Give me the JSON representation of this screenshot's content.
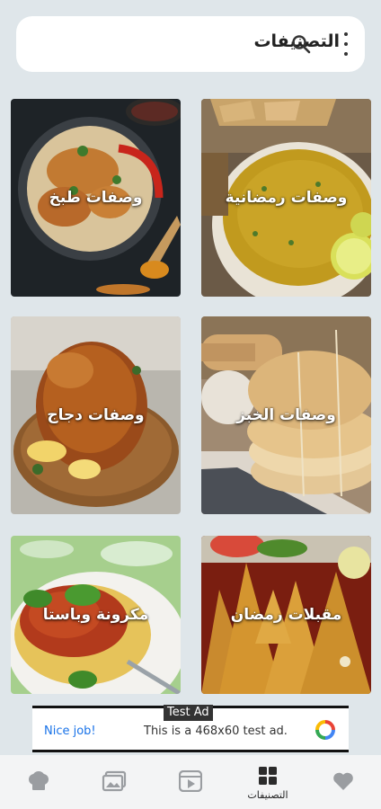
{
  "header": {
    "title": "التصنيفات"
  },
  "categories": [
    {
      "label": "وصفات رمضانية"
    },
    {
      "label": "وصفات طبخ"
    },
    {
      "label": "وصفات الخبز"
    },
    {
      "label": "وصفات دجاج"
    },
    {
      "label": "مقبلات رمضان"
    },
    {
      "label": "مكرونة وباستا"
    }
  ],
  "ad": {
    "tag": "Test Ad",
    "nice": "Nice job!",
    "message": "This is a 468x60 test ad."
  },
  "nav": {
    "active_label": "التصنيفات"
  }
}
